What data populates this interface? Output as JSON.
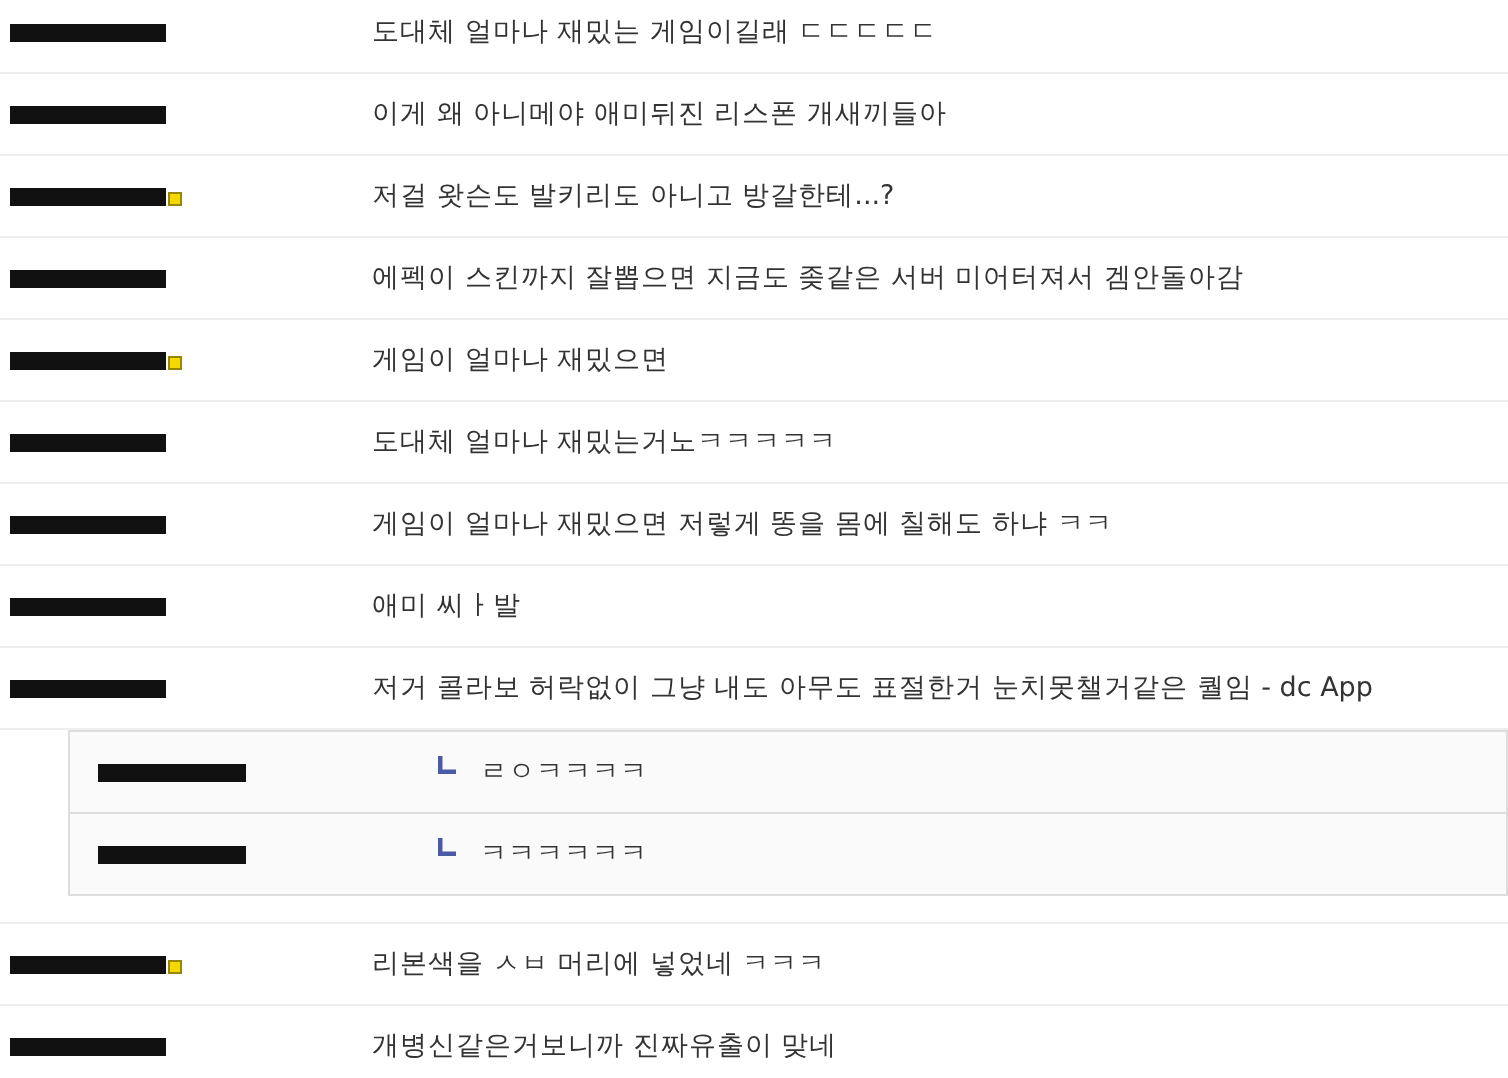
{
  "comments": [
    {
      "badge": false,
      "text": "도대체 얼마나 재밌는 게임이길래 ㄷㄷㄷㄷㄷ"
    },
    {
      "badge": false,
      "text": "이게 왜 아니메야 애미뒤진 리스폰 개새끼들아"
    },
    {
      "badge": true,
      "text": "저걸 왓슨도 발키리도 아니고 방갈한테...?"
    },
    {
      "badge": false,
      "text": "에펙이 스킨까지 잘뽑으면 지금도 좆같은 서버 미어터져서 겜안돌아감"
    },
    {
      "badge": true,
      "text": "게임이 얼마나 재밌으면"
    },
    {
      "badge": false,
      "text": "도대체 얼마나 재밌는거노ㅋㅋㅋㅋㅋ"
    },
    {
      "badge": false,
      "text": "게임이 얼마나 재밌으면 저렇게 똥을 몸에 칠해도 하냐 ㅋㅋ"
    },
    {
      "badge": false,
      "text": "애미 씨ㅏ발"
    },
    {
      "badge": false,
      "text": "저거 콜라보 허락없이 그냥 내도 아무도 표절한거 눈치못챌거같은 퀄임 - dc App",
      "replies": [
        {
          "badge": false,
          "text": "ㄹㅇㅋㅋㅋㅋ"
        },
        {
          "badge": false,
          "text": "ㅋㅋㅋㅋㅋㅋ"
        }
      ]
    },
    {
      "badge": true,
      "text": "리본색을 ㅅㅂ 머리에 넣었네 ㅋㅋㅋ"
    },
    {
      "badge": false,
      "text": "개병신같은거보니까 진짜유출이 맞네"
    }
  ]
}
